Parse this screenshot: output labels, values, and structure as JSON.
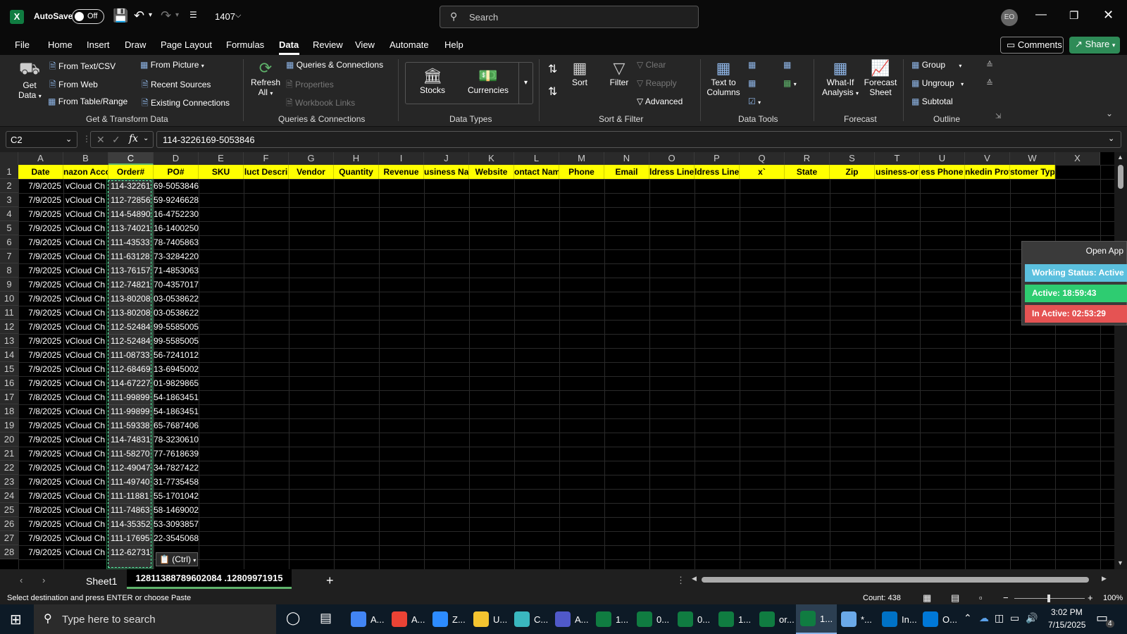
{
  "titlebar": {
    "autosave_label": "AutoSave",
    "autosave_state": "Off",
    "file_name": "1407",
    "search_placeholder": "Search",
    "user_initials": "EO"
  },
  "menu": [
    "File",
    "Home",
    "Insert",
    "Draw",
    "Page Layout",
    "Formulas",
    "Data",
    "Review",
    "View",
    "Automate",
    "Help"
  ],
  "menu_active": "Data",
  "comments_label": "Comments",
  "share_label": "Share",
  "ribbon": {
    "get_data": "Get Data",
    "get_data_l1": "Get",
    "get_data_l2": "Data",
    "from_text_csv": "From Text/CSV",
    "from_web": "From Web",
    "from_table_range": "From Table/Range",
    "from_picture": "From Picture",
    "recent_sources": "Recent Sources",
    "existing_connections": "Existing Connections",
    "group_get_transform": "Get & Transform Data",
    "refresh_l1": "Refresh",
    "refresh_l2": "All",
    "queries_connections": "Queries & Connections",
    "properties": "Properties",
    "workbook_links": "Workbook Links",
    "group_queries": "Queries & Connections",
    "stocks": "Stocks",
    "currencies": "Currencies",
    "group_datatypes": "Data Types",
    "sort": "Sort",
    "filter": "Filter",
    "clear": "Clear",
    "reapply": "Reapply",
    "advanced": "Advanced",
    "group_sort": "Sort & Filter",
    "text_to_columns_l1": "Text to",
    "text_to_columns_l2": "Columns",
    "group_datatools": "Data Tools",
    "whatif_l1": "What-If",
    "whatif_l2": "Analysis",
    "forecast_l1": "Forecast",
    "forecast_l2": "Sheet",
    "group_forecast": "Forecast",
    "group_btn": "Group",
    "ungroup_btn": "Ungroup",
    "subtotal": "Subtotal",
    "group_outline": "Outline"
  },
  "formula_bar": {
    "name_box": "C2",
    "fx": "fx",
    "value": "114-3226169-5053846"
  },
  "columns": [
    "A",
    "B",
    "C",
    "D",
    "E",
    "F",
    "G",
    "H",
    "I",
    "J",
    "K",
    "L",
    "M",
    "N",
    "O",
    "P",
    "Q",
    "R",
    "S",
    "T",
    "U",
    "V",
    "W",
    "X"
  ],
  "headers": [
    "Date",
    "nazon Acco",
    "Order#",
    "PO#",
    "SKU",
    "luct Descri",
    "Vendor",
    "Quantity",
    "Revenue",
    "usiness Nar",
    "Website",
    "ontact Nam",
    "Phone",
    "Email",
    "ldress Line",
    "ldress Line",
    "x`",
    "State",
    "Zip",
    "usiness-or",
    "ess Phone",
    "nkedin Prof",
    "stomer Type"
  ],
  "rows": [
    {
      "n": "2",
      "date": "7/9/2025",
      "acct": "vCloud Ch",
      "order": "114-32261",
      "po": "69-5053846"
    },
    {
      "n": "3",
      "date": "7/9/2025",
      "acct": "vCloud Ch",
      "order": "112-72856",
      "po": "59-9246628"
    },
    {
      "n": "4",
      "date": "7/9/2025",
      "acct": "vCloud Ch",
      "order": "114-54890",
      "po": "16-4752230"
    },
    {
      "n": "5",
      "date": "7/9/2025",
      "acct": "vCloud Ch",
      "order": "113-74021",
      "po": "16-1400250"
    },
    {
      "n": "6",
      "date": "7/9/2025",
      "acct": "vCloud Ch",
      "order": "111-43533",
      "po": "78-7405863"
    },
    {
      "n": "7",
      "date": "7/9/2025",
      "acct": "vCloud Ch",
      "order": "111-63128",
      "po": "73-3284220"
    },
    {
      "n": "8",
      "date": "7/9/2025",
      "acct": "vCloud Ch",
      "order": "113-76157",
      "po": "71-4853063"
    },
    {
      "n": "9",
      "date": "7/9/2025",
      "acct": "vCloud Ch",
      "order": "112-74821",
      "po": "70-4357017"
    },
    {
      "n": "10",
      "date": "7/9/2025",
      "acct": "vCloud Ch",
      "order": "113-80208",
      "po": "03-0538622"
    },
    {
      "n": "11",
      "date": "7/9/2025",
      "acct": "vCloud Ch",
      "order": "113-80208",
      "po": "03-0538622"
    },
    {
      "n": "12",
      "date": "7/9/2025",
      "acct": "vCloud Ch",
      "order": "112-52484",
      "po": "99-5585005"
    },
    {
      "n": "13",
      "date": "7/9/2025",
      "acct": "vCloud Ch",
      "order": "112-52484",
      "po": "99-5585005"
    },
    {
      "n": "14",
      "date": "7/9/2025",
      "acct": "vCloud Ch",
      "order": "111-08733",
      "po": "56-7241012"
    },
    {
      "n": "15",
      "date": "7/9/2025",
      "acct": "vCloud Ch",
      "order": "112-68469",
      "po": "13-6945002"
    },
    {
      "n": "16",
      "date": "7/9/2025",
      "acct": "vCloud Ch",
      "order": "114-67227",
      "po": "01-9829865"
    },
    {
      "n": "17",
      "date": "7/8/2025",
      "acct": "vCloud Ch",
      "order": "111-99899",
      "po": "54-1863451"
    },
    {
      "n": "18",
      "date": "7/8/2025",
      "acct": "vCloud Ch",
      "order": "111-99899",
      "po": "54-1863451"
    },
    {
      "n": "19",
      "date": "7/9/2025",
      "acct": "vCloud Ch",
      "order": "111-59338",
      "po": "65-7687406"
    },
    {
      "n": "20",
      "date": "7/9/2025",
      "acct": "vCloud Ch",
      "order": "114-74831",
      "po": "78-3230610"
    },
    {
      "n": "21",
      "date": "7/9/2025",
      "acct": "vCloud Ch",
      "order": "111-58270",
      "po": "77-7618639"
    },
    {
      "n": "22",
      "date": "7/9/2025",
      "acct": "vCloud Ch",
      "order": "112-49047",
      "po": "34-7827422"
    },
    {
      "n": "23",
      "date": "7/9/2025",
      "acct": "vCloud Ch",
      "order": "111-49740",
      "po": "31-7735458"
    },
    {
      "n": "24",
      "date": "7/9/2025",
      "acct": "vCloud Ch",
      "order": "111-11881",
      "po": "55-1701042"
    },
    {
      "n": "25",
      "date": "7/8/2025",
      "acct": "vCloud Ch",
      "order": "111-74863",
      "po": "58-1469002"
    },
    {
      "n": "26",
      "date": "7/9/2025",
      "acct": "vCloud Ch",
      "order": "114-35352",
      "po": "53-3093857"
    },
    {
      "n": "27",
      "date": "7/9/2025",
      "acct": "vCloud Ch",
      "order": "111-17695",
      "po": "22-3545068"
    },
    {
      "n": "28",
      "date": "7/9/2025",
      "acct": "vCloud Ch",
      "order": "112-62731",
      "po": ""
    }
  ],
  "paste_options": "(Ctrl)",
  "widget": {
    "open_app": "Open App",
    "working_status": "Working Status: Active",
    "active": "Active: 18:59:43",
    "inactive": "In Active: 02:53:29"
  },
  "sheets": [
    "Sheet1",
    "12811388789602084 .12809971915"
  ],
  "status": {
    "message": "Select destination and press ENTER or choose Paste",
    "count": "Count: 438",
    "zoom": "100%"
  },
  "taskbar": {
    "search_placeholder": "Type here to search",
    "apps": [
      "A...",
      "A...",
      "Z...",
      "U...",
      "C...",
      "A...",
      "1...",
      "0...",
      "0...",
      "1...",
      "or...",
      "1...",
      "*...",
      "In...",
      "O..."
    ],
    "time": "3:02 PM",
    "date": "7/15/2025",
    "notif_count": "4"
  },
  "colors": {
    "header_fill": "#ffff00",
    "excel_green": "#107c41",
    "widget_working": "#5bc0de",
    "widget_active": "#2ecc71",
    "widget_inactive": "#e55353"
  }
}
